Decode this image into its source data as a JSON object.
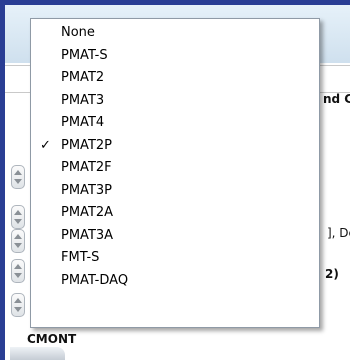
{
  "menu": {
    "items": [
      {
        "label": "None",
        "checked": false
      },
      {
        "label": "PMAT-S",
        "checked": false
      },
      {
        "label": "PMAT2",
        "checked": false
      },
      {
        "label": "PMAT3",
        "checked": false
      },
      {
        "label": "PMAT4",
        "checked": false
      },
      {
        "label": "PMAT2P",
        "checked": true
      },
      {
        "label": "PMAT2F",
        "checked": false
      },
      {
        "label": "PMAT3P",
        "checked": false
      },
      {
        "label": "PMAT2A",
        "checked": false
      },
      {
        "label": "PMAT3A",
        "checked": false
      },
      {
        "label": "FMT-S",
        "checked": false
      },
      {
        "label": "PMAT-DAQ",
        "checked": false
      }
    ],
    "check_glyph": "✓"
  },
  "background": {
    "partial_label_1": "nd C",
    "partial_label_2": "], De",
    "partial_label_3": "2)",
    "bottom_label": "CMONT"
  }
}
